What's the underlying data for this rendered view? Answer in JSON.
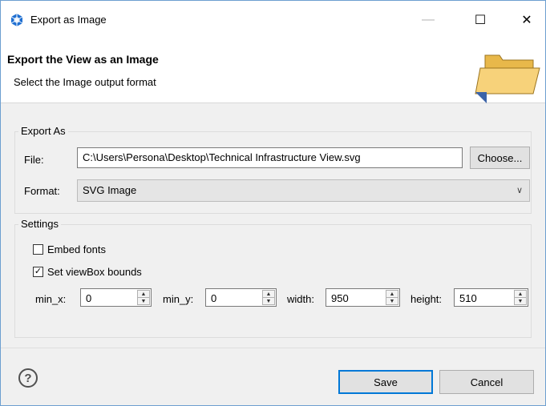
{
  "window": {
    "title": "Export as Image",
    "minimize_glyph": "—",
    "maximize_glyph": "☐",
    "close_glyph": "✕"
  },
  "header": {
    "title": "Export the View as an Image",
    "subtitle": "Select the Image output format"
  },
  "export_as": {
    "group_label": "Export As",
    "file_label": "File:",
    "file_value": "C:\\Users\\Persona\\Desktop\\Technical Infrastructure View.svg",
    "choose_label": "Choose...",
    "format_label": "Format:",
    "format_value": "SVG Image"
  },
  "settings": {
    "group_label": "Settings",
    "embed_fonts_label": "Embed fonts",
    "embed_fonts_checked": false,
    "viewbox_label": "Set viewBox bounds",
    "viewbox_checked": true,
    "fields": [
      {
        "label": "min_x:",
        "value": "0"
      },
      {
        "label": "min_y:",
        "value": "0"
      },
      {
        "label": "width:",
        "value": "950"
      },
      {
        "label": "height:",
        "value": "510"
      }
    ]
  },
  "footer": {
    "help_glyph": "?",
    "save_label": "Save",
    "cancel_label": "Cancel"
  },
  "icons": {
    "app": "eclipse-hex-icon",
    "folder": "open-folder-icon",
    "help": "help-circle-icon"
  }
}
